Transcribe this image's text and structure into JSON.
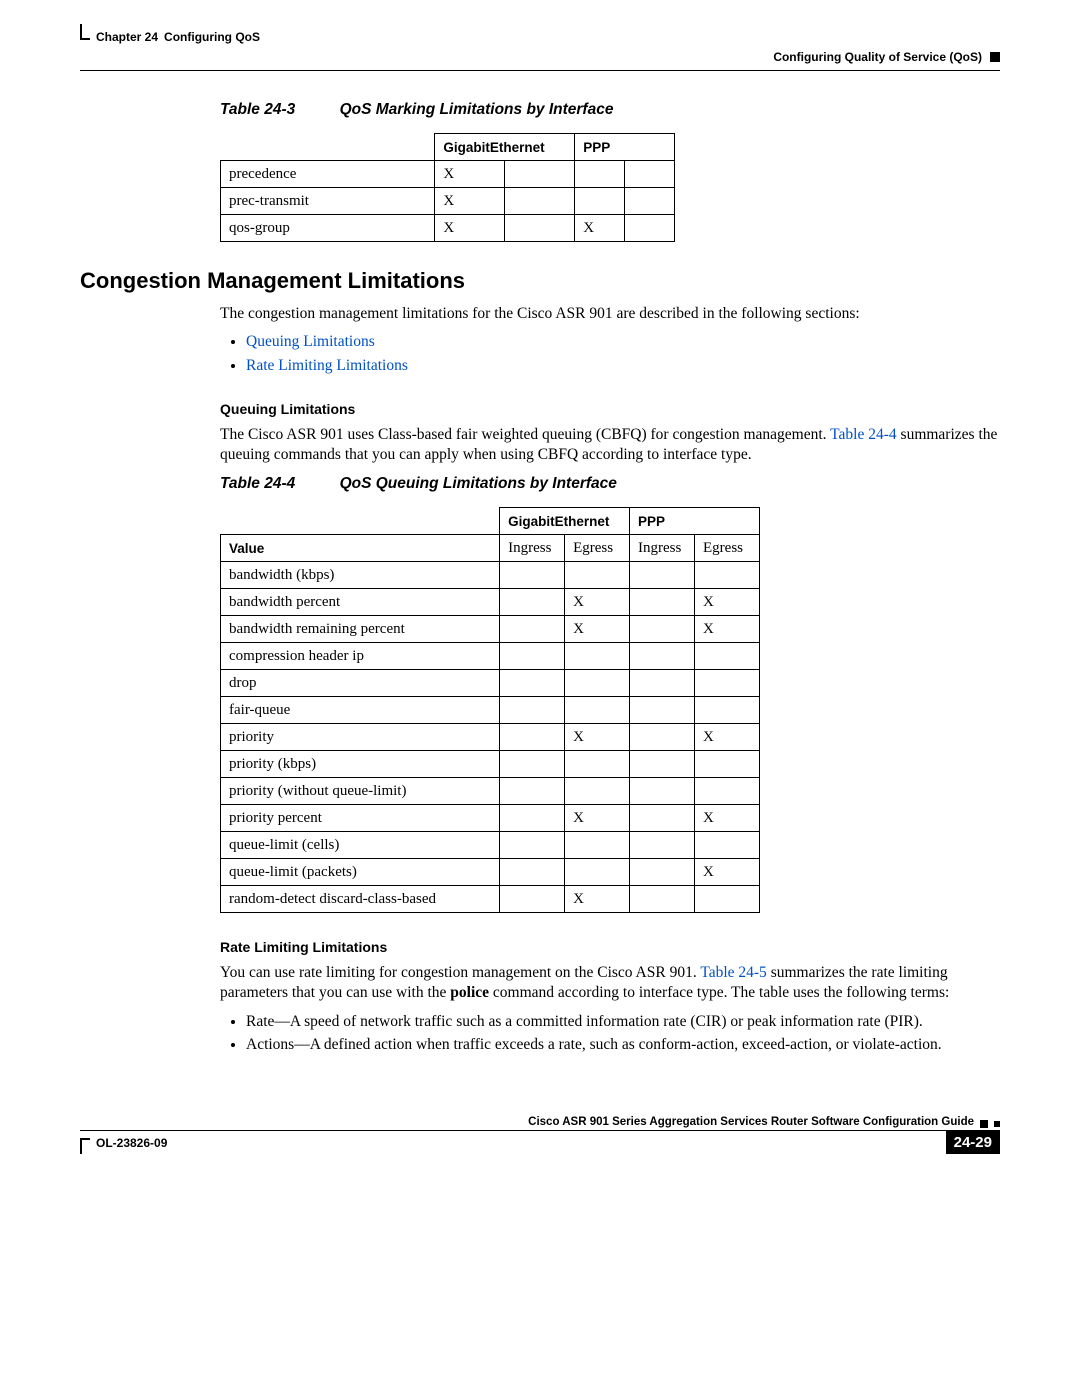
{
  "header": {
    "chapter_label": "Chapter 24",
    "chapter_title": "Configuring QoS",
    "right_title": "Configuring Quality of Service (QoS)"
  },
  "table1": {
    "caption_label": "Table 24-3",
    "caption_title": "QoS Marking Limitations by Interface",
    "col_ge": "GigabitEthernet",
    "col_ppp": "PPP",
    "rows": [
      {
        "label": "precedence",
        "ge1": "X",
        "ge2": "",
        "ppp1": "",
        "ppp2": ""
      },
      {
        "label": "prec-transmit",
        "ge1": "X",
        "ge2": "",
        "ppp1": "",
        "ppp2": ""
      },
      {
        "label": "qos-group",
        "ge1": "X",
        "ge2": "",
        "ppp1": "X",
        "ppp2": ""
      }
    ]
  },
  "section": {
    "title": "Congestion Management Limitations",
    "intro": "The congestion management limitations for the Cisco ASR 901 are described in the following sections:",
    "links": {
      "queuing": "Queuing Limitations",
      "ratelimit": "Rate Limiting Limitations"
    }
  },
  "queuing": {
    "heading": "Queuing Limitations",
    "para_pre": "The Cisco ASR 901 uses Class-based fair weighted queuing (CBFQ) for congestion management. ",
    "table_ref": "Table 24-4",
    "para_post": " summarizes the queuing commands that you can apply when using CBFQ according to interface type."
  },
  "table2": {
    "caption_label": "Table 24-4",
    "caption_title": "QoS Queuing Limitations by Interface",
    "col_ge": "GigabitEthernet",
    "col_ppp": "PPP",
    "value_label": "Value",
    "ingress": "Ingress",
    "egress": "Egress",
    "rows": [
      {
        "label": "bandwidth (kbps)",
        "gi": "",
        "ge": "",
        "pi": "",
        "pe": ""
      },
      {
        "label": "bandwidth percent",
        "gi": "",
        "ge": "X",
        "pi": "",
        "pe": "X"
      },
      {
        "label": "bandwidth remaining percent",
        "gi": "",
        "ge": "X",
        "pi": "",
        "pe": "X"
      },
      {
        "label": "compression header ip",
        "gi": "",
        "ge": "",
        "pi": "",
        "pe": ""
      },
      {
        "label": "drop",
        "gi": "",
        "ge": "",
        "pi": "",
        "pe": ""
      },
      {
        "label": "fair-queue",
        "gi": "",
        "ge": "",
        "pi": "",
        "pe": ""
      },
      {
        "label": "priority",
        "gi": "",
        "ge": "X",
        "pi": "",
        "pe": "X"
      },
      {
        "label": "priority (kbps)",
        "gi": "",
        "ge": "",
        "pi": "",
        "pe": ""
      },
      {
        "label": "priority (without queue-limit)",
        "gi": "",
        "ge": "",
        "pi": "",
        "pe": ""
      },
      {
        "label": "priority percent",
        "gi": "",
        "ge": "X",
        "pi": "",
        "pe": "X"
      },
      {
        "label": "queue-limit (cells)",
        "gi": "",
        "ge": "",
        "pi": "",
        "pe": ""
      },
      {
        "label": "queue-limit (packets)",
        "gi": "",
        "ge": "",
        "pi": "",
        "pe": "X"
      },
      {
        "label": "random-detect discard-class-based",
        "gi": "",
        "ge": "X",
        "pi": "",
        "pe": ""
      }
    ]
  },
  "ratelimit": {
    "heading": "Rate Limiting Limitations",
    "para_pre": "You can use rate limiting for congestion management on the Cisco ASR 901. ",
    "table_ref": "Table 24-5",
    "para_mid": " summarizes the rate limiting parameters that you can use with the ",
    "police_word": "police",
    "para_post": " command according to interface type. The table uses the following terms:",
    "bullet1": "Rate—A speed of network traffic such as a committed information rate (CIR) or peak information rate (PIR).",
    "bullet2": "Actions—A defined action when traffic exceeds a rate, such as conform-action, exceed-action, or violate-action."
  },
  "footer": {
    "guide_title": "Cisco ASR 901 Series Aggregation Services Router Software Configuration Guide",
    "doc_id": "OL-23826-09",
    "page_num": "24-29"
  }
}
